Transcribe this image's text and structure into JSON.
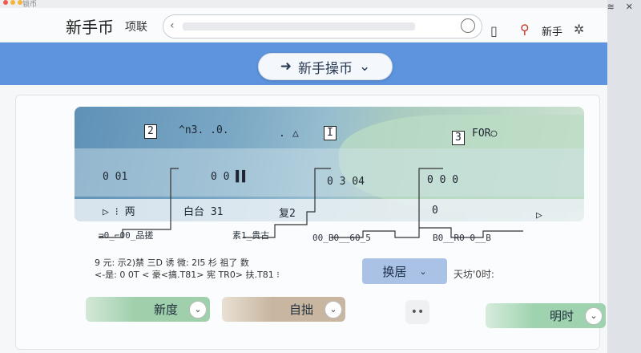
{
  "window": {
    "title_fragment": "锁币"
  },
  "header": {
    "app_title": "新手币",
    "nav_link": "项联",
    "user_name": "新手"
  },
  "toolbar": {
    "op_button_label": "新手操币"
  },
  "map": {
    "row1": {
      "a": "2",
      "b": "^n3. .0.",
      "c": ".",
      "d": "△",
      "e": "I",
      "f": "3",
      "g": "FOR○"
    },
    "row2": {
      "a": "0  01",
      "b": "0 0  ▌▌",
      "c": "0  3  04",
      "d": "0  0  0"
    },
    "row3": {
      "a": "▷   ⁝     两",
      "b": "白台 31",
      "c": "复2",
      "d": "0",
      "e": "▷"
    }
  },
  "graph_labels": {
    "l1": "ᴟ0_⌐00_品搓",
    "l2": "素1_贵古",
    "l3": "00_B0__60_5",
    "l4": "B0__R0 0__B"
  },
  "info": {
    "line1": "9 元:  示2)禁   三D 诱  微:   2I5 杉   祖了 数",
    "line2": "<-是:  0 0T <   豪<搞.T81>  宪 TR0>   扶.T81 ⁝"
  },
  "controls": {
    "switch_label": "换居",
    "time_label": "天坊'0时:",
    "pill1_label": "新度",
    "pill2_label": "自拙",
    "pill3_label": "明时"
  },
  "colors": {
    "blue_band": "#5d94dd",
    "pill1": "#9fcfab",
    "pill2": "#c8b6a0",
    "pill3": "#9fd3b0",
    "switch_button": "#a9c2e6"
  }
}
